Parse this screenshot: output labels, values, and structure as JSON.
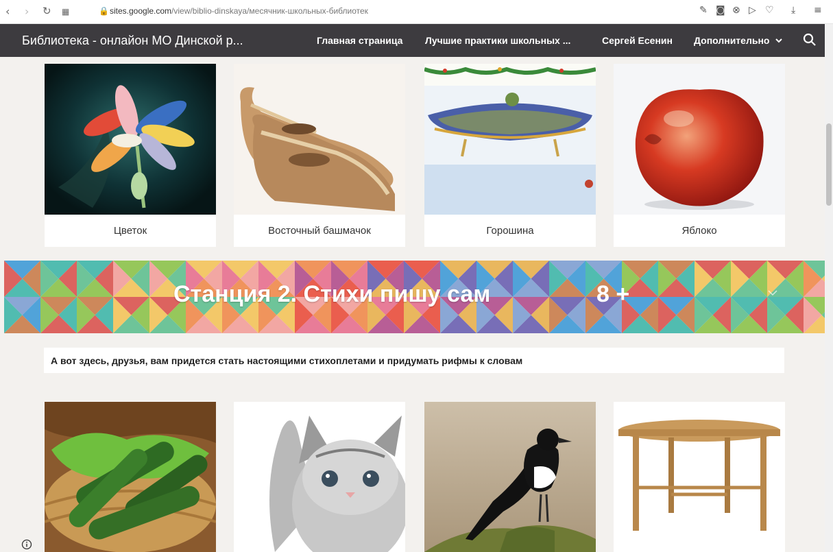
{
  "browser": {
    "url_domain": "sites.google.com",
    "url_path": "/view/biblio-dinskaya/месячник-школьных-библиотек"
  },
  "header": {
    "site_title": "Библиотека - онлайон МО Динской р...",
    "nav": [
      "Главная страница",
      "Лучшие практики школьных ...",
      "Сергей Есенин",
      "Дополнительно"
    ]
  },
  "gallery1": {
    "items": [
      {
        "caption": "Цветок",
        "icon": "flower-image"
      },
      {
        "caption": "Восточный башмачок",
        "icon": "slipper-image"
      },
      {
        "caption": "Горошина",
        "icon": "pea-cushion-image"
      },
      {
        "caption": "Яблоко",
        "icon": "apple-image"
      }
    ]
  },
  "banner": {
    "title": "Станция 2. Стихи пишу сам",
    "age": "8 +"
  },
  "intro_text": "А вот здесь, друзья, вам придется стать настоящими стихоплетами и придумать рифмы к словам",
  "gallery2": {
    "items": [
      {
        "icon": "cucumbers-image"
      },
      {
        "icon": "kitten-image"
      },
      {
        "icon": "magpie-image"
      },
      {
        "icon": "table-image"
      }
    ]
  },
  "colors": {
    "header_bg": "#3d3b3f",
    "page_bg": "#f3f1ee"
  }
}
